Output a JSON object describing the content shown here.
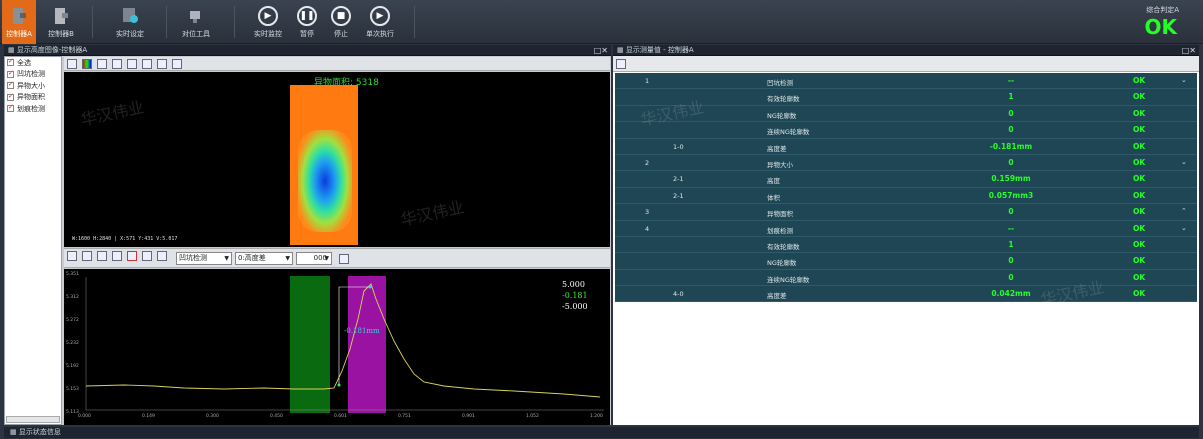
{
  "toolbar": {
    "buttons": [
      {
        "label": "控制器A",
        "icon": "controller-a-icon",
        "active": true
      },
      {
        "label": "控制器B",
        "icon": "controller-b-icon",
        "active": false
      },
      {
        "label": "实时设定",
        "icon": "settings-icon",
        "active": false
      },
      {
        "label": "对位工具",
        "icon": "alignment-tool-icon",
        "active": false
      },
      {
        "label": "实时监控",
        "icon": "play-icon",
        "active": false
      },
      {
        "label": "暂停",
        "icon": "pause-icon",
        "active": false
      },
      {
        "label": "停止",
        "icon": "stop-icon",
        "active": false
      },
      {
        "label": "单次执行",
        "icon": "single-run-icon",
        "active": false
      }
    ],
    "verdict_label": "综合判定A",
    "verdict_value": "OK",
    "verdict_color": "#22ff22",
    "accent_color": "#e36a18"
  },
  "left_panel": {
    "title": "显示高度图像-控制器A",
    "checklist": [
      "全选",
      "凹坑检测",
      "异物大小",
      "异物面积",
      "划痕检测"
    ],
    "image_overlay": "异物面积: 5318",
    "image_info": "W:1600 H:2840 | X:571 Y:431 V:5.017",
    "selects": {
      "item": "凹坑检测",
      "mode": "0:高度差",
      "number": "000"
    },
    "graph": {
      "y_ticks": [
        "5.351",
        "5.312",
        "5.272",
        "5.232",
        "5.192",
        "5.153",
        "5.113"
      ],
      "x_ticks": [
        "0.000",
        "0.149",
        "0.300",
        "0.450",
        "0.601",
        "0.751",
        "0.901",
        "1.052",
        "1.200"
      ],
      "legend": [
        "5.000",
        "-0.181",
        "-5.000"
      ],
      "annotation": "-0.181mm"
    }
  },
  "right_panel": {
    "title": "显示测量值 - 控制器A",
    "rows": [
      {
        "id": "1",
        "sub": "",
        "name": "凹坑检测",
        "value": "--",
        "result": "OK",
        "expander": "⌄"
      },
      {
        "id": "",
        "sub": "",
        "name": "有效轮廓数",
        "value": "1",
        "result": "OK",
        "expander": ""
      },
      {
        "id": "",
        "sub": "",
        "name": "NG轮廓数",
        "value": "0",
        "result": "OK",
        "expander": ""
      },
      {
        "id": "",
        "sub": "",
        "name": "连续NG轮廓数",
        "value": "0",
        "result": "OK",
        "expander": ""
      },
      {
        "id": "",
        "sub": "1-0",
        "name": "高度差",
        "value": "-0.181mm",
        "result": "OK",
        "expander": ""
      },
      {
        "id": "2",
        "sub": "",
        "name": "异物大小",
        "value": "0",
        "result": "OK",
        "expander": "⌄"
      },
      {
        "id": "",
        "sub": "2-1",
        "name": "高度",
        "value": "0.159mm",
        "result": "OK",
        "expander": ""
      },
      {
        "id": "",
        "sub": "2-1",
        "name": "体积",
        "value": "0.057mm3",
        "result": "OK",
        "expander": ""
      },
      {
        "id": "3",
        "sub": "",
        "name": "异物面积",
        "value": "0",
        "result": "OK",
        "expander": "⌃"
      },
      {
        "id": "4",
        "sub": "",
        "name": "划痕检测",
        "value": "--",
        "result": "OK",
        "expander": "⌄"
      },
      {
        "id": "",
        "sub": "",
        "name": "有效轮廓数",
        "value": "1",
        "result": "OK",
        "expander": ""
      },
      {
        "id": "",
        "sub": "",
        "name": "NG轮廓数",
        "value": "0",
        "result": "OK",
        "expander": ""
      },
      {
        "id": "",
        "sub": "",
        "name": "连续NG轮廓数",
        "value": "0",
        "result": "OK",
        "expander": ""
      },
      {
        "id": "",
        "sub": "4-0",
        "name": "高度差",
        "value": "0.042mm",
        "result": "OK",
        "expander": ""
      }
    ]
  },
  "status_bar": {
    "title": "显示状态信息"
  },
  "watermark": "华汉伟业"
}
